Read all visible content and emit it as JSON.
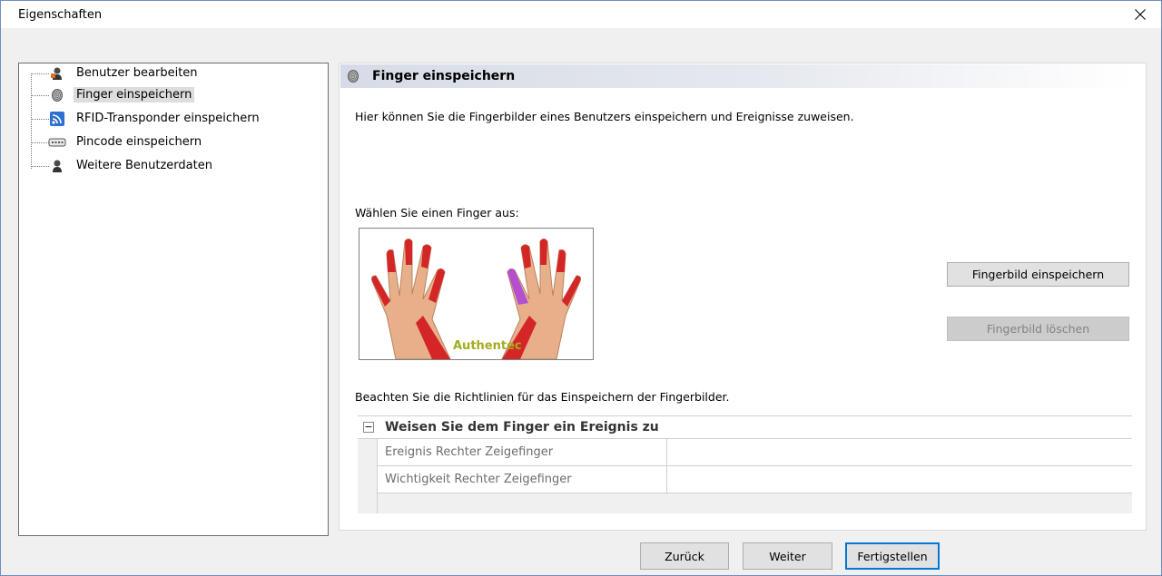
{
  "window": {
    "title": "Eigenschaften"
  },
  "tree": {
    "items": [
      {
        "label": "Benutzer bearbeiten",
        "icon": "user-edit-icon"
      },
      {
        "label": "Finger einspeichern",
        "icon": "fingerprint-icon"
      },
      {
        "label": "RFID-Transponder einspeichern",
        "icon": "rfid-icon"
      },
      {
        "label": "Pincode einspeichern",
        "icon": "keypad-icon"
      },
      {
        "label": "Weitere Benutzerdaten",
        "icon": "user-data-icon"
      }
    ]
  },
  "panel": {
    "title": "Finger einspeichern",
    "description": "Hier können Sie die Fingerbilder eines Benutzers einspeichern und Ereignisse zuweisen.",
    "choose_label": "Wählen Sie einen Finger aus:",
    "hands_brand": "Authentec",
    "save_button": "Fingerbild einspeichern",
    "delete_button": "Fingerbild löschen",
    "guidelines": "Beachten Sie die Richtlinien für das Einspeichern der Fingerbilder.",
    "grid": {
      "category": "Weisen Sie dem Finger ein Ereignis zu",
      "toggle": "−",
      "rows": [
        {
          "name": "Ereignis Rechter Zeigefinger",
          "value": ""
        },
        {
          "name": "Wichtigkeit Rechter Zeigefinger",
          "value": ""
        }
      ]
    }
  },
  "footer": {
    "back": "Zurück",
    "next": "Weiter",
    "finish": "Fertigstellen"
  }
}
